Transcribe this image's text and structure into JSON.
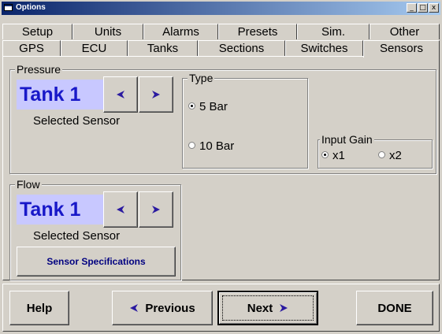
{
  "window": {
    "title": "Options",
    "minimize": "_",
    "maximize": "□",
    "close": "x"
  },
  "tabs_row1": [
    "Setup",
    "Units",
    "Alarms",
    "Presets",
    "Sim.",
    "Other"
  ],
  "tabs_row2": [
    "GPS",
    "ECU",
    "Tanks",
    "Sections",
    "Switches",
    "Sensors"
  ],
  "active_tab": "Sensors",
  "pressure": {
    "legend": "Pressure",
    "tank_label": "Tank 1",
    "selected_caption": "Selected Sensor",
    "type": {
      "legend": "Type",
      "options": [
        {
          "label": "5 Bar",
          "checked": true
        },
        {
          "label": "10 Bar",
          "checked": false
        }
      ]
    },
    "input_gain": {
      "legend": "Input Gain",
      "options": [
        {
          "label": "x1",
          "checked": true
        },
        {
          "label": "x2",
          "checked": false
        }
      ]
    }
  },
  "flow": {
    "legend": "Flow",
    "tank_label": "Tank 1",
    "selected_caption": "Selected Sensor",
    "specs_button": "Sensor Specifications"
  },
  "footer": {
    "help": "Help",
    "previous": "Previous",
    "next": "Next",
    "done": "DONE"
  },
  "colors": {
    "accent_arrow": "#2a1aa0",
    "tank_bg": "#c8c8ff",
    "tank_text": "#1818c8"
  }
}
